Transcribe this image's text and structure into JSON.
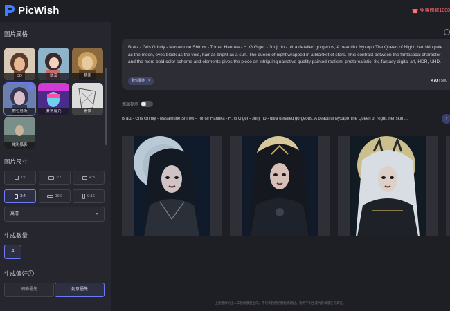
{
  "app": {
    "name": "PicWish",
    "promo_text": "免費體驗1000"
  },
  "sidebar": {
    "style_section_title": "圖片風格",
    "styles": [
      {
        "label": "3D",
        "selected": false
      },
      {
        "label": "動漫",
        "selected": false
      },
      {
        "label": "藝術",
        "selected": false
      },
      {
        "label": "數位藝術",
        "selected": true
      },
      {
        "label": "賽博龐克",
        "selected": false
      },
      {
        "label": "素描",
        "selected": false
      },
      {
        "label": "電影攝影",
        "selected": false
      }
    ],
    "size_section_title": "圖片尺寸",
    "sizes": [
      {
        "label": "1:1",
        "selected": false
      },
      {
        "label": "3:2",
        "selected": false
      },
      {
        "label": "4:3",
        "selected": false
      },
      {
        "label": "3:4",
        "selected": true
      },
      {
        "label": "16:9",
        "selected": false
      },
      {
        "label": "9:16",
        "selected": false
      }
    ],
    "quality_select": "高清",
    "count_section_title": "生成數量",
    "count_value": "4",
    "preference_section_title": "生成偏好",
    "preferences": [
      {
        "label": "細節優先",
        "selected": false
      },
      {
        "label": "創意優先",
        "selected": true
      }
    ]
  },
  "main": {
    "prompt_text": "Bratz - Gris Grimly - Masamune Shirow - Tomer Hanuka - H. G Giger - Junji Ito - ultra detailed gorgeous, A beautiful Nyxapo The Queen of Night, her skin pale as the moon, eyes black as the void, hair as bright as a sun.  The queen of night wrapped in a blanket of stars. This contrast between the fantastical character and the more bold color scheme and elements gives the piece an intriguing narrative quality painted realism, photorealistic, 8k, fantasy digital art, HDR, UHD.",
    "style_tag": "數位藝術",
    "char_count_current": "470",
    "char_count_max": "/ 500",
    "toggle_label": "添加提示",
    "result_prompt": "Bratz - Gris Grimly - Masamune Shirow - Tomer Hanuka - H. G Giger - Junji Ito - ultra detailed gorgeous, A beautiful Nyxapo The Queen of Night, her skin ...",
    "footer_note": "上述圖像均由人工智能模型生成，不代表我們的觀點或觀點。我們不對生成內容承擔任何責任。"
  },
  "colors": {
    "accent": "#6f79f0",
    "promo": "#ff6b6b",
    "background": "#1e1f24",
    "panel": "#26272e"
  },
  "icons": [
    "picwish-logo-icon",
    "gift-icon",
    "help-icon",
    "info-icon",
    "up-arrow-icon",
    "close-icon",
    "chevron-down-icon"
  ]
}
